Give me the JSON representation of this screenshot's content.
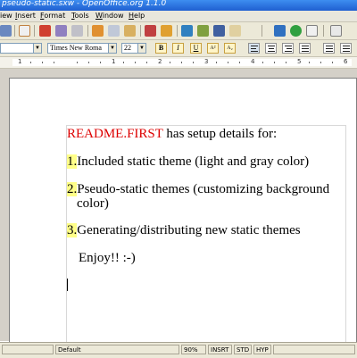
{
  "window": {
    "title": "pseudo-static.sxw - OpenOffice.org 1.1.0"
  },
  "menu": {
    "items": [
      {
        "prefix": "",
        "u": "",
        "rest": "iew"
      },
      {
        "prefix": "",
        "u": "I",
        "rest": "nsert"
      },
      {
        "prefix": "",
        "u": "F",
        "rest": "ormat"
      },
      {
        "prefix": "",
        "u": "T",
        "rest": "ools"
      },
      {
        "prefix": "",
        "u": "W",
        "rest": "indow"
      },
      {
        "prefix": "",
        "u": "H",
        "rest": "elp"
      }
    ]
  },
  "format": {
    "font_name": "Times New Roma",
    "font_size": "22",
    "bold": "B",
    "italic": "I",
    "underline": "U"
  },
  "ruler": {
    "numbers": [
      "1",
      "1",
      "2",
      "3",
      "4",
      "5",
      "6"
    ]
  },
  "document": {
    "line1_red": "README.FIRST",
    "line1_rest": " has setup details for:",
    "item1_num": "1.",
    "item1_text": "Included static theme (light and gray color)",
    "item2_num": "2.",
    "item2_text": "Pseudo-static themes (customizing background",
    "item2_cont": "color)",
    "item3_num": "3.",
    "item3_text": "Generating/distributing new static themes",
    "closing": "Enjoy!! :-)"
  },
  "status": {
    "style": "Default",
    "zoom": "90%",
    "insert": "INSRT",
    "std": "STD",
    "hyp": "HYP"
  },
  "colors": {
    "accent_red": "#dd0000",
    "highlight": "#ffff88",
    "titlebar": "#2a6fe0"
  }
}
